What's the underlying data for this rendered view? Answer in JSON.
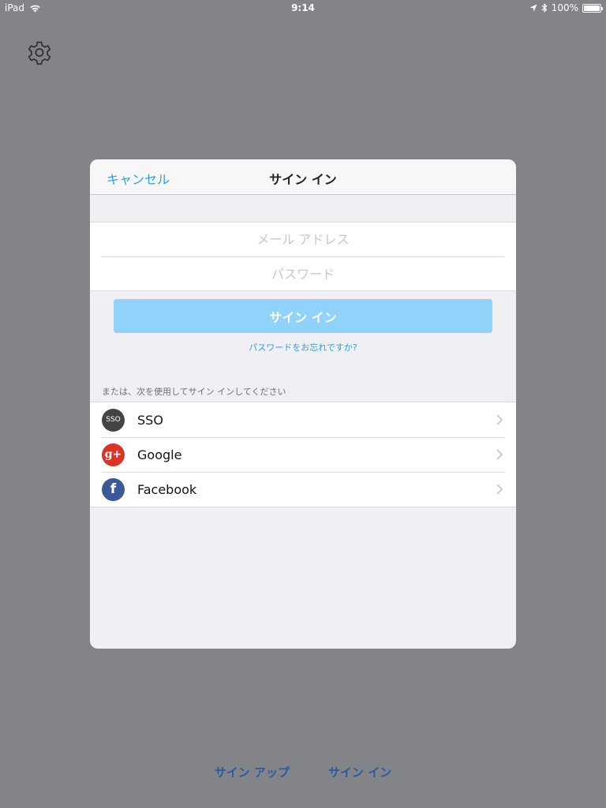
{
  "status_bar": {
    "device": "iPad",
    "time": "9:14",
    "battery": "100%",
    "battery_level": 1.0
  },
  "modal": {
    "cancel_label": "キャンセル",
    "title": "サイン イン",
    "email_placeholder": "メール アドレス",
    "password_placeholder": "パスワード",
    "signin_button": "サイン イン",
    "forgot_link": "パスワードをお忘れですか?",
    "or_label": "または、次を使用してサイン インしてください",
    "providers": [
      {
        "icon_text": "SSO",
        "label": "SSO",
        "icon": "sso-icon"
      },
      {
        "icon_text": "g+",
        "label": "Google",
        "icon": "google-plus-icon"
      },
      {
        "icon_text": "f",
        "label": "Facebook",
        "icon": "facebook-icon"
      }
    ]
  },
  "bottom": {
    "signup_label": "サイン アップ",
    "signin_label": "サイン イン"
  },
  "colors": {
    "accent": "#2aa1e8",
    "button": "#90d2f9",
    "backdrop": "#838488",
    "bottom_link": "#2c5aa0"
  }
}
